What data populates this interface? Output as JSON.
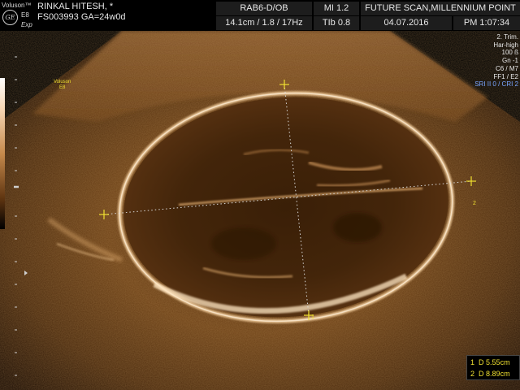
{
  "header": {
    "brand": "Voluson™",
    "logo_mark": "GE",
    "model": "E8",
    "edition": "Exp",
    "patient_name": "RINKAL HITESH, *",
    "patient_id_ga": "FS003993 GA=24w0d",
    "probe_mode": "RAB6-D/OB",
    "depth_info": "14.1cm / 1.8 / 17Hz",
    "mi": "MI 1.2",
    "tib": "TIb 0.8",
    "institution": "FUTURE SCAN,MILLENNIUM POINT",
    "date": "04.07.2016",
    "time": "PM 1:07:34"
  },
  "probe_label": {
    "line1": "Voluson",
    "line2": "E8"
  },
  "params": {
    "trim": "2. Trim.",
    "harmonic": "Har-high",
    "power": "100 ß",
    "gain": "Gn -1",
    "c_m": "C6 / M7",
    "ff": "FF1 / E2",
    "sri": "SRI II 0 / CRI 2"
  },
  "markers": {
    "caliper_1": "1",
    "caliper_2": "2"
  },
  "measurements": [
    {
      "index": "1",
      "label": "D",
      "value": "5.55cm"
    },
    {
      "index": "2",
      "label": "D",
      "value": "8.89cm"
    }
  ],
  "colors": {
    "caliper": "#f0e030",
    "sepia_light": "#f7d7b5",
    "sepia_mid": "#c68a4c",
    "sepia_dark": "#5e3410",
    "param_blue": "#79a5ff"
  },
  "icons": {
    "logo": "ge-logo-icon",
    "caliper": "caliper-cross-icon"
  }
}
